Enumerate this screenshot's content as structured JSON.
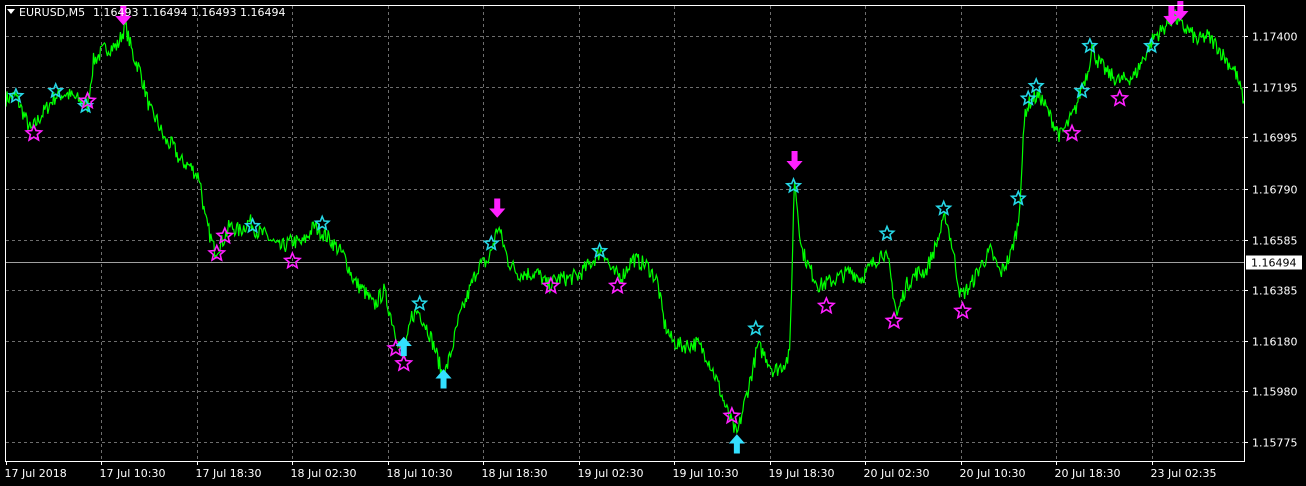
{
  "header": {
    "symbol_timeframe": "EURUSD,M5",
    "ohlc": "1.16493 1.16494 1.16493 1.16494"
  },
  "colors": {
    "background": "#000000",
    "grid": "#6e6e6e",
    "frame": "#ffffff",
    "price_line": "#00ff00",
    "buy_star": "#26d7e6",
    "sell_star": "#ff20ff",
    "up_arrow": "#33e0ff",
    "down_arrow": "#ff20ff",
    "bid_line": "#a0a0a0"
  },
  "chart_data": {
    "type": "line",
    "title": "EURUSD,M5",
    "ylim": [
      1.157,
      1.1752
    ],
    "y_ticks": [
      "1.17400",
      "1.17195",
      "1.16995",
      "1.16790",
      "1.16585",
      "1.16385",
      "1.16180",
      "1.15980",
      "1.15775"
    ],
    "current_price": "1.16494",
    "grid": true,
    "x_tick_labels": [
      "17 Jul 2018",
      "17 Jul 10:30",
      "17 Jul 18:30",
      "18 Jul 02:30",
      "18 Jul 10:30",
      "18 Jul 18:30",
      "19 Jul 02:30",
      "19 Jul 10:30",
      "19 Jul 18:30",
      "20 Jul 02:30",
      "20 Jul 10:30",
      "20 Jul 18:30",
      "23 Jul 02:35"
    ],
    "x_tick_bar_index": [
      0,
      96,
      192,
      288,
      384,
      480,
      576,
      672,
      768,
      864,
      960,
      1056,
      1152
    ],
    "bar_count": 1245,
    "series": [
      {
        "values_by_bar": [
          [
            0,
            1.1715
          ],
          [
            10,
            1.1716
          ],
          [
            25,
            1.1702
          ],
          [
            35,
            1.1708
          ],
          [
            50,
            1.1716
          ],
          [
            60,
            1.1717
          ],
          [
            75,
            1.1714
          ],
          [
            82,
            1.1712
          ],
          [
            88,
            1.173
          ],
          [
            100,
            1.1735
          ],
          [
            112,
            1.1736
          ],
          [
            120,
            1.1744
          ],
          [
            128,
            1.1732
          ],
          [
            135,
            1.1726
          ],
          [
            145,
            1.171
          ],
          [
            152,
            1.1706
          ],
          [
            160,
            1.1698
          ],
          [
            168,
            1.1696
          ],
          [
            175,
            1.169
          ],
          [
            185,
            1.1688
          ],
          [
            195,
            1.1683
          ],
          [
            200,
            1.1667
          ],
          [
            210,
            1.1654
          ],
          [
            218,
            1.1658
          ],
          [
            225,
            1.1664
          ],
          [
            235,
            1.1662
          ],
          [
            245,
            1.1666
          ],
          [
            252,
            1.1662
          ],
          [
            262,
            1.166
          ],
          [
            275,
            1.1655
          ],
          [
            288,
            1.1658
          ],
          [
            298,
            1.1657
          ],
          [
            310,
            1.1664
          ],
          [
            325,
            1.1659
          ],
          [
            340,
            1.1652
          ],
          [
            350,
            1.1642
          ],
          [
            360,
            1.1638
          ],
          [
            370,
            1.1632
          ],
          [
            380,
            1.1638
          ],
          [
            390,
            1.1624
          ],
          [
            400,
            1.161
          ],
          [
            408,
            1.1628
          ],
          [
            415,
            1.163
          ],
          [
            425,
            1.1622
          ],
          [
            432,
            1.1614
          ],
          [
            440,
            1.1603
          ],
          [
            448,
            1.1614
          ],
          [
            455,
            1.1626
          ],
          [
            465,
            1.1637
          ],
          [
            475,
            1.1648
          ],
          [
            485,
            1.165
          ],
          [
            495,
            1.1664
          ],
          [
            505,
            1.165
          ],
          [
            515,
            1.1645
          ],
          [
            525,
            1.1645
          ],
          [
            535,
            1.1645
          ],
          [
            545,
            1.164
          ],
          [
            555,
            1.1643
          ],
          [
            565,
            1.1643
          ],
          [
            575,
            1.1644
          ],
          [
            590,
            1.165
          ],
          [
            600,
            1.1655
          ],
          [
            610,
            1.1645
          ],
          [
            620,
            1.1644
          ],
          [
            630,
            1.1651
          ],
          [
            645,
            1.1648
          ],
          [
            655,
            1.1642
          ],
          [
            662,
            1.1625
          ],
          [
            670,
            1.1618
          ],
          [
            680,
            1.1616
          ],
          [
            695,
            1.1617
          ],
          [
            705,
            1.1612
          ],
          [
            715,
            1.1602
          ],
          [
            725,
            1.159
          ],
          [
            735,
            1.158
          ],
          [
            742,
            1.1592
          ],
          [
            750,
            1.1605
          ],
          [
            756,
            1.1616
          ],
          [
            764,
            1.1612
          ],
          [
            772,
            1.1606
          ],
          [
            780,
            1.1608
          ],
          [
            788,
            1.1612
          ],
          [
            793,
            1.1683
          ],
          [
            800,
            1.1655
          ],
          [
            808,
            1.1647
          ],
          [
            818,
            1.164
          ],
          [
            830,
            1.1642
          ],
          [
            840,
            1.1644
          ],
          [
            850,
            1.1646
          ],
          [
            860,
            1.1643
          ],
          [
            870,
            1.1648
          ],
          [
            882,
            1.1654
          ],
          [
            888,
            1.1648
          ],
          [
            896,
            1.1628
          ],
          [
            905,
            1.164
          ],
          [
            915,
            1.1645
          ],
          [
            925,
            1.1646
          ],
          [
            935,
            1.1656
          ],
          [
            945,
            1.1668
          ],
          [
            952,
            1.1655
          ],
          [
            960,
            1.1636
          ],
          [
            970,
            1.164
          ],
          [
            980,
            1.1648
          ],
          [
            990,
            1.1654
          ],
          [
            1000,
            1.1645
          ],
          [
            1010,
            1.1652
          ],
          [
            1018,
            1.1665
          ],
          [
            1025,
            1.171
          ],
          [
            1032,
            1.1715
          ],
          [
            1040,
            1.1716
          ],
          [
            1050,
            1.1708
          ],
          [
            1060,
            1.17
          ],
          [
            1068,
            1.1705
          ],
          [
            1075,
            1.171
          ],
          [
            1082,
            1.172
          ],
          [
            1088,
            1.1726
          ],
          [
            1092,
            1.1736
          ],
          [
            1098,
            1.173
          ],
          [
            1108,
            1.1725
          ],
          [
            1120,
            1.1722
          ],
          [
            1135,
            1.1724
          ],
          [
            1145,
            1.1732
          ],
          [
            1155,
            1.174
          ],
          [
            1162,
            1.1742
          ],
          [
            1168,
            1.1745
          ],
          [
            1175,
            1.1748
          ],
          [
            1182,
            1.1744
          ],
          [
            1190,
            1.1742
          ],
          [
            1198,
            1.1738
          ],
          [
            1208,
            1.174
          ],
          [
            1218,
            1.1736
          ],
          [
            1228,
            1.173
          ],
          [
            1236,
            1.1726
          ],
          [
            1245,
            1.1714
          ]
        ]
      }
    ],
    "signals": {
      "buy_stars": [
        [
          10,
          1.1716
        ],
        [
          50,
          1.1718
        ],
        [
          80,
          1.1712
        ],
        [
          248,
          1.1664
        ],
        [
          318,
          1.1665
        ],
        [
          416,
          1.1633
        ],
        [
          488,
          1.1657
        ],
        [
          597,
          1.1654
        ],
        [
          754,
          1.1623
        ],
        [
          792,
          1.168
        ],
        [
          886,
          1.1661
        ],
        [
          943,
          1.1671
        ],
        [
          1018,
          1.1675
        ],
        [
          1028,
          1.1715
        ],
        [
          1036,
          1.172
        ],
        [
          1082,
          1.1718
        ],
        [
          1090,
          1.1736
        ],
        [
          1152,
          1.1736
        ]
      ],
      "sell_stars": [
        [
          28,
          1.1701
        ],
        [
          82,
          1.1714
        ],
        [
          212,
          1.1653
        ],
        [
          220,
          1.166
        ],
        [
          288,
          1.165
        ],
        [
          392,
          1.1615
        ],
        [
          400,
          1.1609
        ],
        [
          548,
          1.164
        ],
        [
          615,
          1.164
        ],
        [
          730,
          1.1588
        ],
        [
          825,
          1.1632
        ],
        [
          893,
          1.1626
        ],
        [
          962,
          1.163
        ],
        [
          1072,
          1.1701
        ],
        [
          1120,
          1.1715
        ]
      ],
      "up_arrows": [
        [
          400,
          1.1617
        ],
        [
          440,
          1.1604
        ],
        [
          735,
          1.1578
        ]
      ],
      "down_arrows": [
        [
          118,
          1.1747
        ],
        [
          494,
          1.167
        ],
        [
          793,
          1.1689
        ],
        [
          1172,
          1.1747
        ],
        [
          1181,
          1.1749
        ]
      ]
    }
  }
}
